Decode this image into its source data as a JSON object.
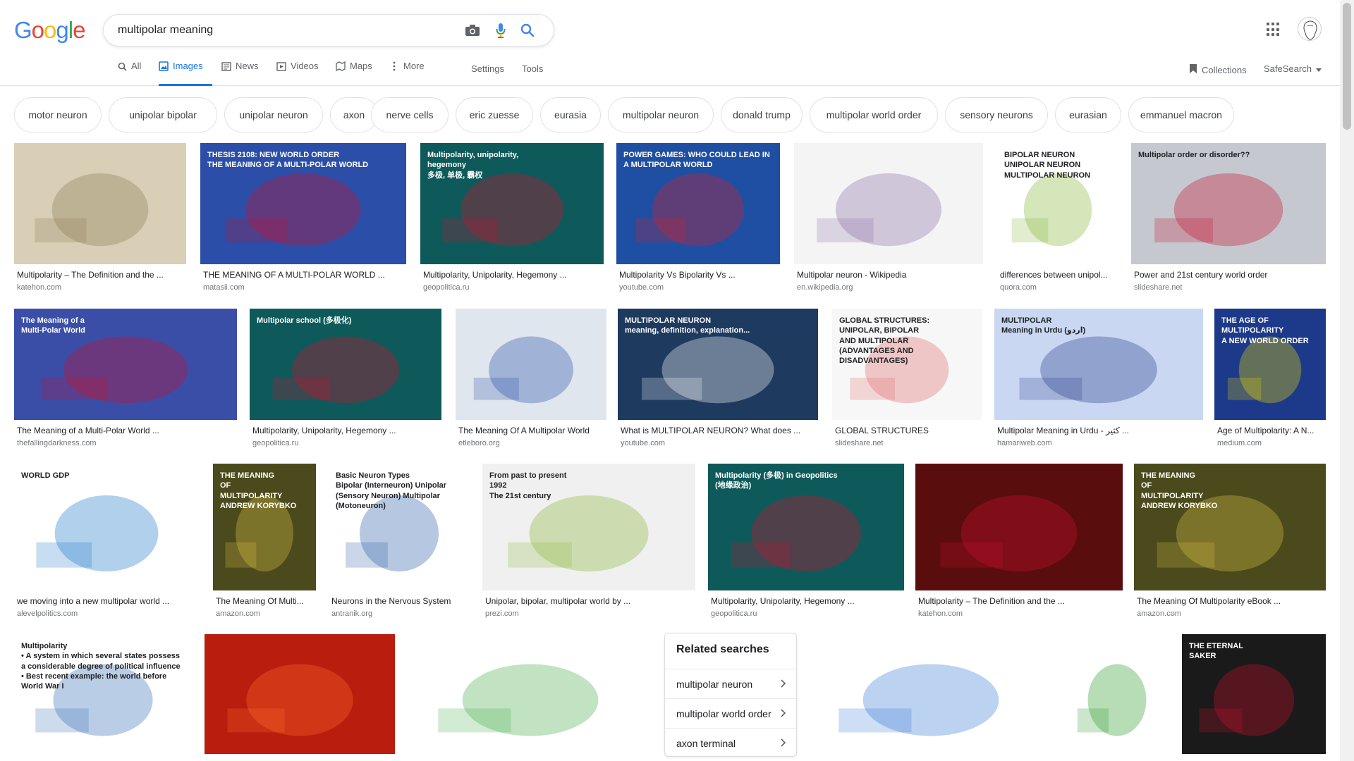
{
  "search": {
    "query": "multipolar meaning"
  },
  "nav": {
    "tabs": [
      {
        "label": "All",
        "icon": "search-icon"
      },
      {
        "label": "Images",
        "icon": "image-icon",
        "active": true
      },
      {
        "label": "News",
        "icon": "news-icon"
      },
      {
        "label": "Videos",
        "icon": "video-icon"
      },
      {
        "label": "Maps",
        "icon": "map-icon"
      },
      {
        "label": "More",
        "icon": "more-vert-icon"
      }
    ],
    "settings": "Settings",
    "tools": "Tools",
    "collections": "Collections",
    "safesearch": "SafeSearch"
  },
  "chips": [
    "motor neuron",
    "unipolar bipolar",
    "unipolar neuron",
    "axon",
    "nerve cells",
    "eric zuesse",
    "eurasia",
    "multipolar neuron",
    "donald trump",
    "multipolar world order",
    "sensory neurons",
    "eurasian",
    "emmanuel macron"
  ],
  "results": [
    {
      "caption": "Multipolarity – The Definition and the ...",
      "domain": "katehon.com",
      "thumb_text": "",
      "color": "#d9cfb6",
      "accent": "#8b7a55"
    },
    {
      "caption": "THE MEANING OF A MULTI-POLAR WORLD ...",
      "domain": "matasii.com",
      "thumb_text": "THESIS 2108: NEW WORLD ORDER\nTHE MEANING OF A MULTI-POLAR WORLD",
      "color": "#2b4fa8",
      "accent": "#c8102e"
    },
    {
      "caption": "Multipolarity, Unipolarity, Hegemony ...",
      "domain": "geopolitica.ru",
      "thumb_text": "Multipolarity, unipolarity,\nhegemony\n多极, 单极, 霸权",
      "color": "#0e5a5a",
      "accent": "#c8102e"
    },
    {
      "caption": "Multipolarity Vs Bipolarity Vs ...",
      "domain": "youtube.com",
      "thumb_text": "POWER GAMES: WHO COULD LEAD IN A MULTIPOLAR WORLD",
      "color": "#1f4fa3",
      "accent": "#d81f26"
    },
    {
      "caption": "Multipolar neuron - Wikipedia",
      "domain": "en.wikipedia.org",
      "thumb_text": "",
      "color": "#f4f4f4",
      "accent": "#8a6fa8"
    },
    {
      "caption": "differences between unipol...",
      "domain": "quora.com",
      "thumb_text": "BIPOLAR NEURON\nUNIPOLAR NEURON\nMULTIPOLAR NEURON",
      "color": "#ffffff",
      "accent": "#86b83a"
    },
    {
      "caption": "Power and 21st century world order",
      "domain": "slideshare.net",
      "thumb_text": "Multipolar order or disorder??",
      "color": "#c5c9cf",
      "accent": "#c8102e"
    },
    {
      "caption": "The Meaning of a Multi-Polar World ...",
      "domain": "thefallingdarkness.com",
      "thumb_text": "The Meaning of a\nMulti-Polar World",
      "color": "#3a4ea8",
      "accent": "#c8102e"
    },
    {
      "caption": "Multipolarity, Unipolarity, Hegemony ...",
      "domain": "geopolitica.ru",
      "thumb_text": "Multipolar school (多极化)",
      "color": "#0e5a5a",
      "accent": "#c8102e"
    },
    {
      "caption": "The Meaning Of A Multipolar World",
      "domain": "etleboro.org",
      "thumb_text": "",
      "color": "#dfe6ee",
      "accent": "#2b4fa8"
    },
    {
      "caption": "What is MULTIPOLAR NEURON? What does ...",
      "domain": "youtube.com",
      "thumb_text": "MULTIPOLAR NEURON\nmeaning, definition, explanation...",
      "color": "#1e3a5f",
      "accent": "#ffffff"
    },
    {
      "caption": "GLOBAL STRUCTURES",
      "domain": "slideshare.net",
      "thumb_text": "GLOBAL STRUCTURES:\nUNIPOLAR, BIPOLAR\nAND MULTIPOLAR\n(ADVANTAGES AND DISADVANTAGES)",
      "color": "#f7f7f7",
      "accent": "#e06b6b"
    },
    {
      "caption": "Multipolar Meaning in Urdu - کثیر ...",
      "domain": "hamariweb.com",
      "thumb_text": "MULTIPOLAR\nMeaning in Urdu (اردو)",
      "color": "#c9d7f2",
      "accent": "#2a3e8c"
    },
    {
      "caption": "Age of Multipolarity: A N...",
      "domain": "medium.com",
      "thumb_text": "THE AGE OF\nMULTIPOLARITY\nA NEW WORLD ORDER",
      "color": "#1d3a8a",
      "accent": "#e8d800"
    },
    {
      "caption": "we moving into a new multipolar world ...",
      "domain": "alevelpolitics.com",
      "thumb_text": "WORLD GDP",
      "color": "#ffffff",
      "accent": "#1f78c8"
    },
    {
      "caption": "The Meaning Of Multi...",
      "domain": "amazon.com",
      "thumb_text": "THE MEANING\nOF\nMULTIPOLARITY\nANDREW KORYBKO",
      "color": "#4b4a1c",
      "accent": "#d9c045"
    },
    {
      "caption": "Neurons in the Nervous System",
      "domain": "antranik.org",
      "thumb_text": "Basic Neuron Types\nBipolar (Interneuron)   Unipolar (Sensory Neuron)   Multipolar (Motoneuron)",
      "color": "#ffffff",
      "accent": "#2e5fa8"
    },
    {
      "caption": "Unipolar, bipolar, multipolar world by ...",
      "domain": "prezi.com",
      "thumb_text": "From past to present\n1992\nThe 21st century",
      "color": "#f0f0f0",
      "accent": "#8ab83a"
    },
    {
      "caption": "Multipolarity, Unipolarity, Hegemony ...",
      "domain": "geopolitica.ru",
      "thumb_text": "Multipolarity (多极) in Geopolitics\n(地缘政治)",
      "color": "#0e5a5a",
      "accent": "#c8102e"
    },
    {
      "caption": "Multipolarity – The Definition and the ...",
      "domain": "katehon.com",
      "thumb_text": "",
      "color": "#5a0d0d",
      "accent": "#c8102e"
    },
    {
      "caption": "The Meaning Of Multipolarity eBook ...",
      "domain": "amazon.com",
      "thumb_text": "THE MEANING\nOF\nMULTIPOLARITY\nANDREW KORYBKO",
      "color": "#4b4a1c",
      "accent": "#d9c045"
    },
    {
      "caption": "",
      "domain": "",
      "thumb_text": "Multipolarity\n• A system in which several states possess a considerable degree of political influence\n• Best recent example: the world before World War I",
      "color": "#ffffff",
      "accent": "#3a6fb8"
    },
    {
      "caption": "",
      "domain": "",
      "thumb_text": "",
      "color": "#b81d0d",
      "accent": "#ff6a2a"
    },
    {
      "caption": "",
      "domain": "",
      "thumb_text": "",
      "color": "#ffffff",
      "accent": "#4caf50"
    },
    {
      "caption": "",
      "domain": "",
      "thumb_text": "",
      "color": "#ffffff",
      "accent": "#3b7dd8"
    },
    {
      "caption": "",
      "domain": "",
      "thumb_text": "",
      "color": "#ffffff",
      "accent": "#2e9d2e"
    },
    {
      "caption": "",
      "domain": "",
      "thumb_text": "THE ETERNAL\nSAKER",
      "color": "#1a1a1a",
      "accent": "#c8102e"
    }
  ],
  "related": {
    "title": "Related searches",
    "items": [
      "multipolar neuron",
      "multipolar world order",
      "axon terminal"
    ]
  }
}
